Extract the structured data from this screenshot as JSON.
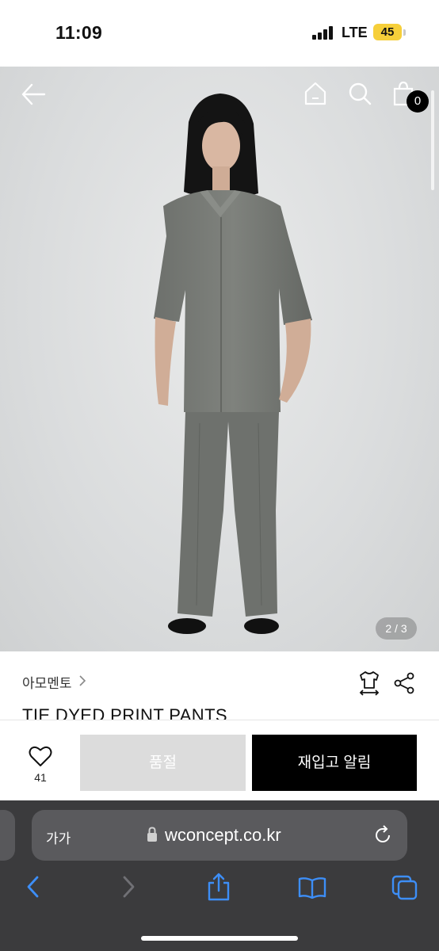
{
  "status_bar": {
    "time": "11:09",
    "network": "LTE",
    "battery": "45"
  },
  "header": {
    "back_icon": "arrow-left-icon",
    "home_icon": "home-icon",
    "search_icon": "search-icon",
    "cart_icon": "shopping-bag-icon",
    "cart_count": "0"
  },
  "gallery": {
    "page_indicator": "2 / 3"
  },
  "product": {
    "brand": "아모멘토",
    "title": "TIE DYED PRINT PANTS",
    "size_icon": "size-guide-icon",
    "share_icon": "share-icon"
  },
  "action_bar": {
    "like_icon": "heart-icon",
    "like_count": "41",
    "soldout_label": "품절",
    "notify_label": "재입고 알림"
  },
  "browser": {
    "text_size_label": "가가",
    "url": "wconcept.co.kr"
  },
  "colors": {
    "accent": "#000000",
    "soldout": "#dcdcdc",
    "battery": "#f6cf3a",
    "safari_bar": "#3b3b3d",
    "ios_blue": "#3d8ef7"
  }
}
